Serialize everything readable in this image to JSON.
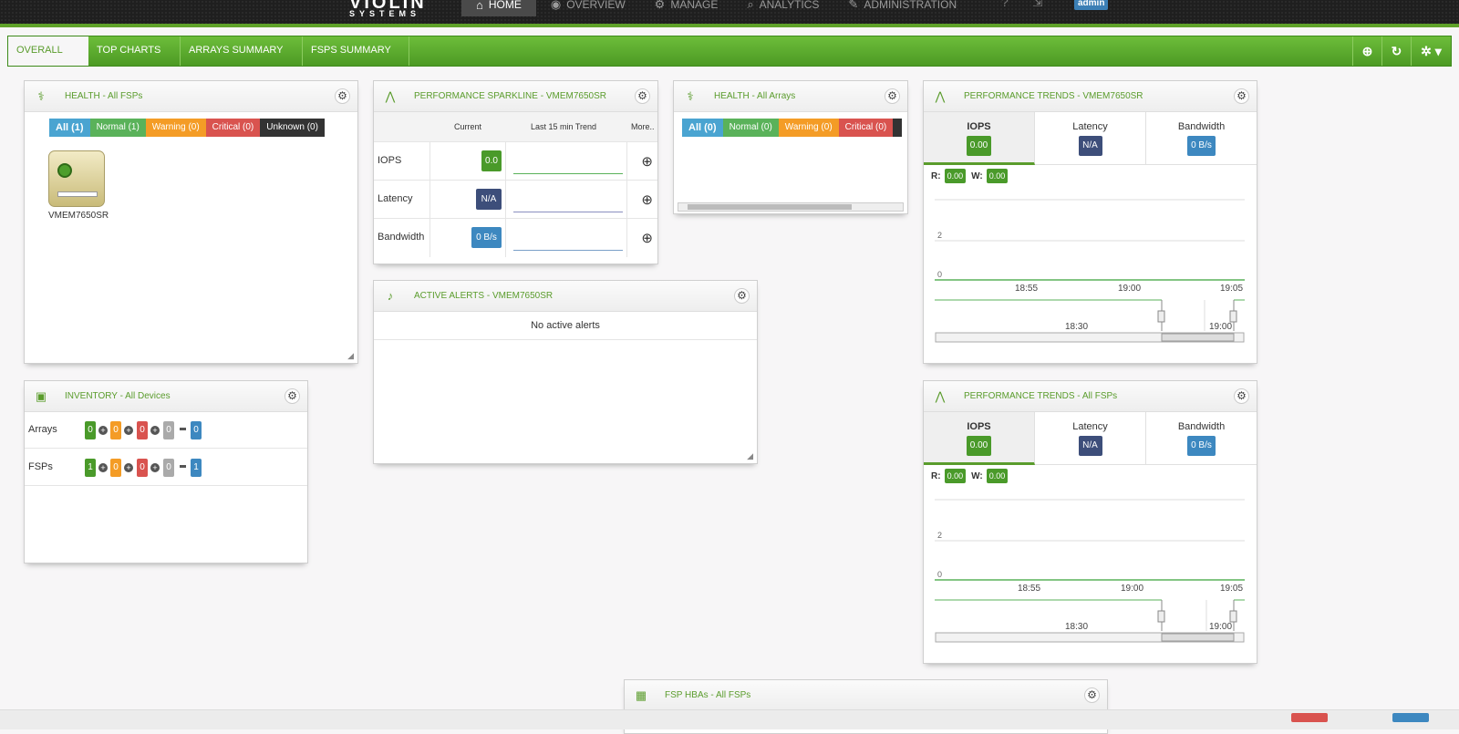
{
  "app": {
    "logo_line1": "VIOLIN",
    "logo_line2": "SYSTEMS",
    "user": "admin"
  },
  "nav": [
    {
      "label": "HOME",
      "icon": "home-icon",
      "active": true
    },
    {
      "label": "OVERVIEW",
      "icon": "eye-icon",
      "active": false
    },
    {
      "label": "MANAGE",
      "icon": "gears-icon",
      "active": false
    },
    {
      "label": "ANALYTICS",
      "icon": "search-icon",
      "active": false
    },
    {
      "label": "ADMINISTRATION",
      "icon": "wrench-icon",
      "active": false
    }
  ],
  "tabs": [
    "OVERALL",
    "TOP CHARTS",
    "ARRAYS SUMMARY",
    "FSPS SUMMARY"
  ],
  "health_fsps": {
    "title": "HEALTH - All FSPs",
    "filters": [
      "All (1)",
      "Normal (1)",
      "Warning (0)",
      "Critical (0)",
      "Unknown (0)"
    ],
    "device": "VMEM7650SR"
  },
  "sparkline": {
    "title": "PERFORMANCE SPARKLINE - VMEM7650SR",
    "headers": {
      "current": "Current",
      "trend": "Last 15 min Trend",
      "more": "More.."
    },
    "rows": [
      {
        "label": "IOPS",
        "value": "0.0",
        "color": "#4a9a2a",
        "line": "#5ab25a"
      },
      {
        "label": "Latency",
        "value": "N/A",
        "color": "#3d4e7a",
        "line": "#8a8fc0"
      },
      {
        "label": "Bandwidth",
        "value": "0 B/s",
        "color": "#3d88c0",
        "line": "#7aa0c8"
      }
    ]
  },
  "health_arrays": {
    "title": "HEALTH - All Arrays",
    "filters": [
      "All (0)",
      "Normal (0)",
      "Warning (0)",
      "Critical (0)"
    ]
  },
  "alerts": {
    "title": "ACTIVE ALERTS - VMEM7650SR",
    "empty": "No active alerts"
  },
  "inventory": {
    "title": "INVENTORY - All Devices",
    "rows": [
      {
        "label": "Arrays",
        "values": [
          "0",
          "0",
          "0",
          "0"
        ],
        "total": "0"
      },
      {
        "label": "FSPs",
        "values": [
          "1",
          "0",
          "0",
          "0"
        ],
        "total": "1"
      }
    ]
  },
  "trends": [
    {
      "title": "PERFORMANCE TRENDS - VMEM7650SR",
      "tabs": [
        {
          "label": "IOPS",
          "value": "0.00"
        },
        {
          "label": "Latency",
          "value": "N/A"
        },
        {
          "label": "Bandwidth",
          "value": "0 B/s"
        }
      ],
      "r_label": "R:",
      "r_value": "0.00",
      "w_label": "W:",
      "w_value": "0.00",
      "y_ticks": [
        "2",
        "0"
      ],
      "x_ticks": [
        "18:55",
        "19:00",
        "19:05"
      ],
      "nav_ticks": [
        "18:30",
        "19:00"
      ]
    },
    {
      "title": "PERFORMANCE TRENDS - All FSPs",
      "tabs": [
        {
          "label": "IOPS",
          "value": "0.00"
        },
        {
          "label": "Latency",
          "value": "N/A"
        },
        {
          "label": "Bandwidth",
          "value": "0 B/s"
        }
      ],
      "r_label": "R:",
      "r_value": "0.00",
      "w_label": "W:",
      "w_value": "0.00",
      "y_ticks": [
        "2",
        "0"
      ],
      "x_ticks": [
        "18:55",
        "19:00",
        "19:05"
      ],
      "nav_ticks": [
        "18:30",
        "19:00"
      ]
    }
  ],
  "hbas": {
    "title": "FSP HBAs - All FSPs"
  }
}
